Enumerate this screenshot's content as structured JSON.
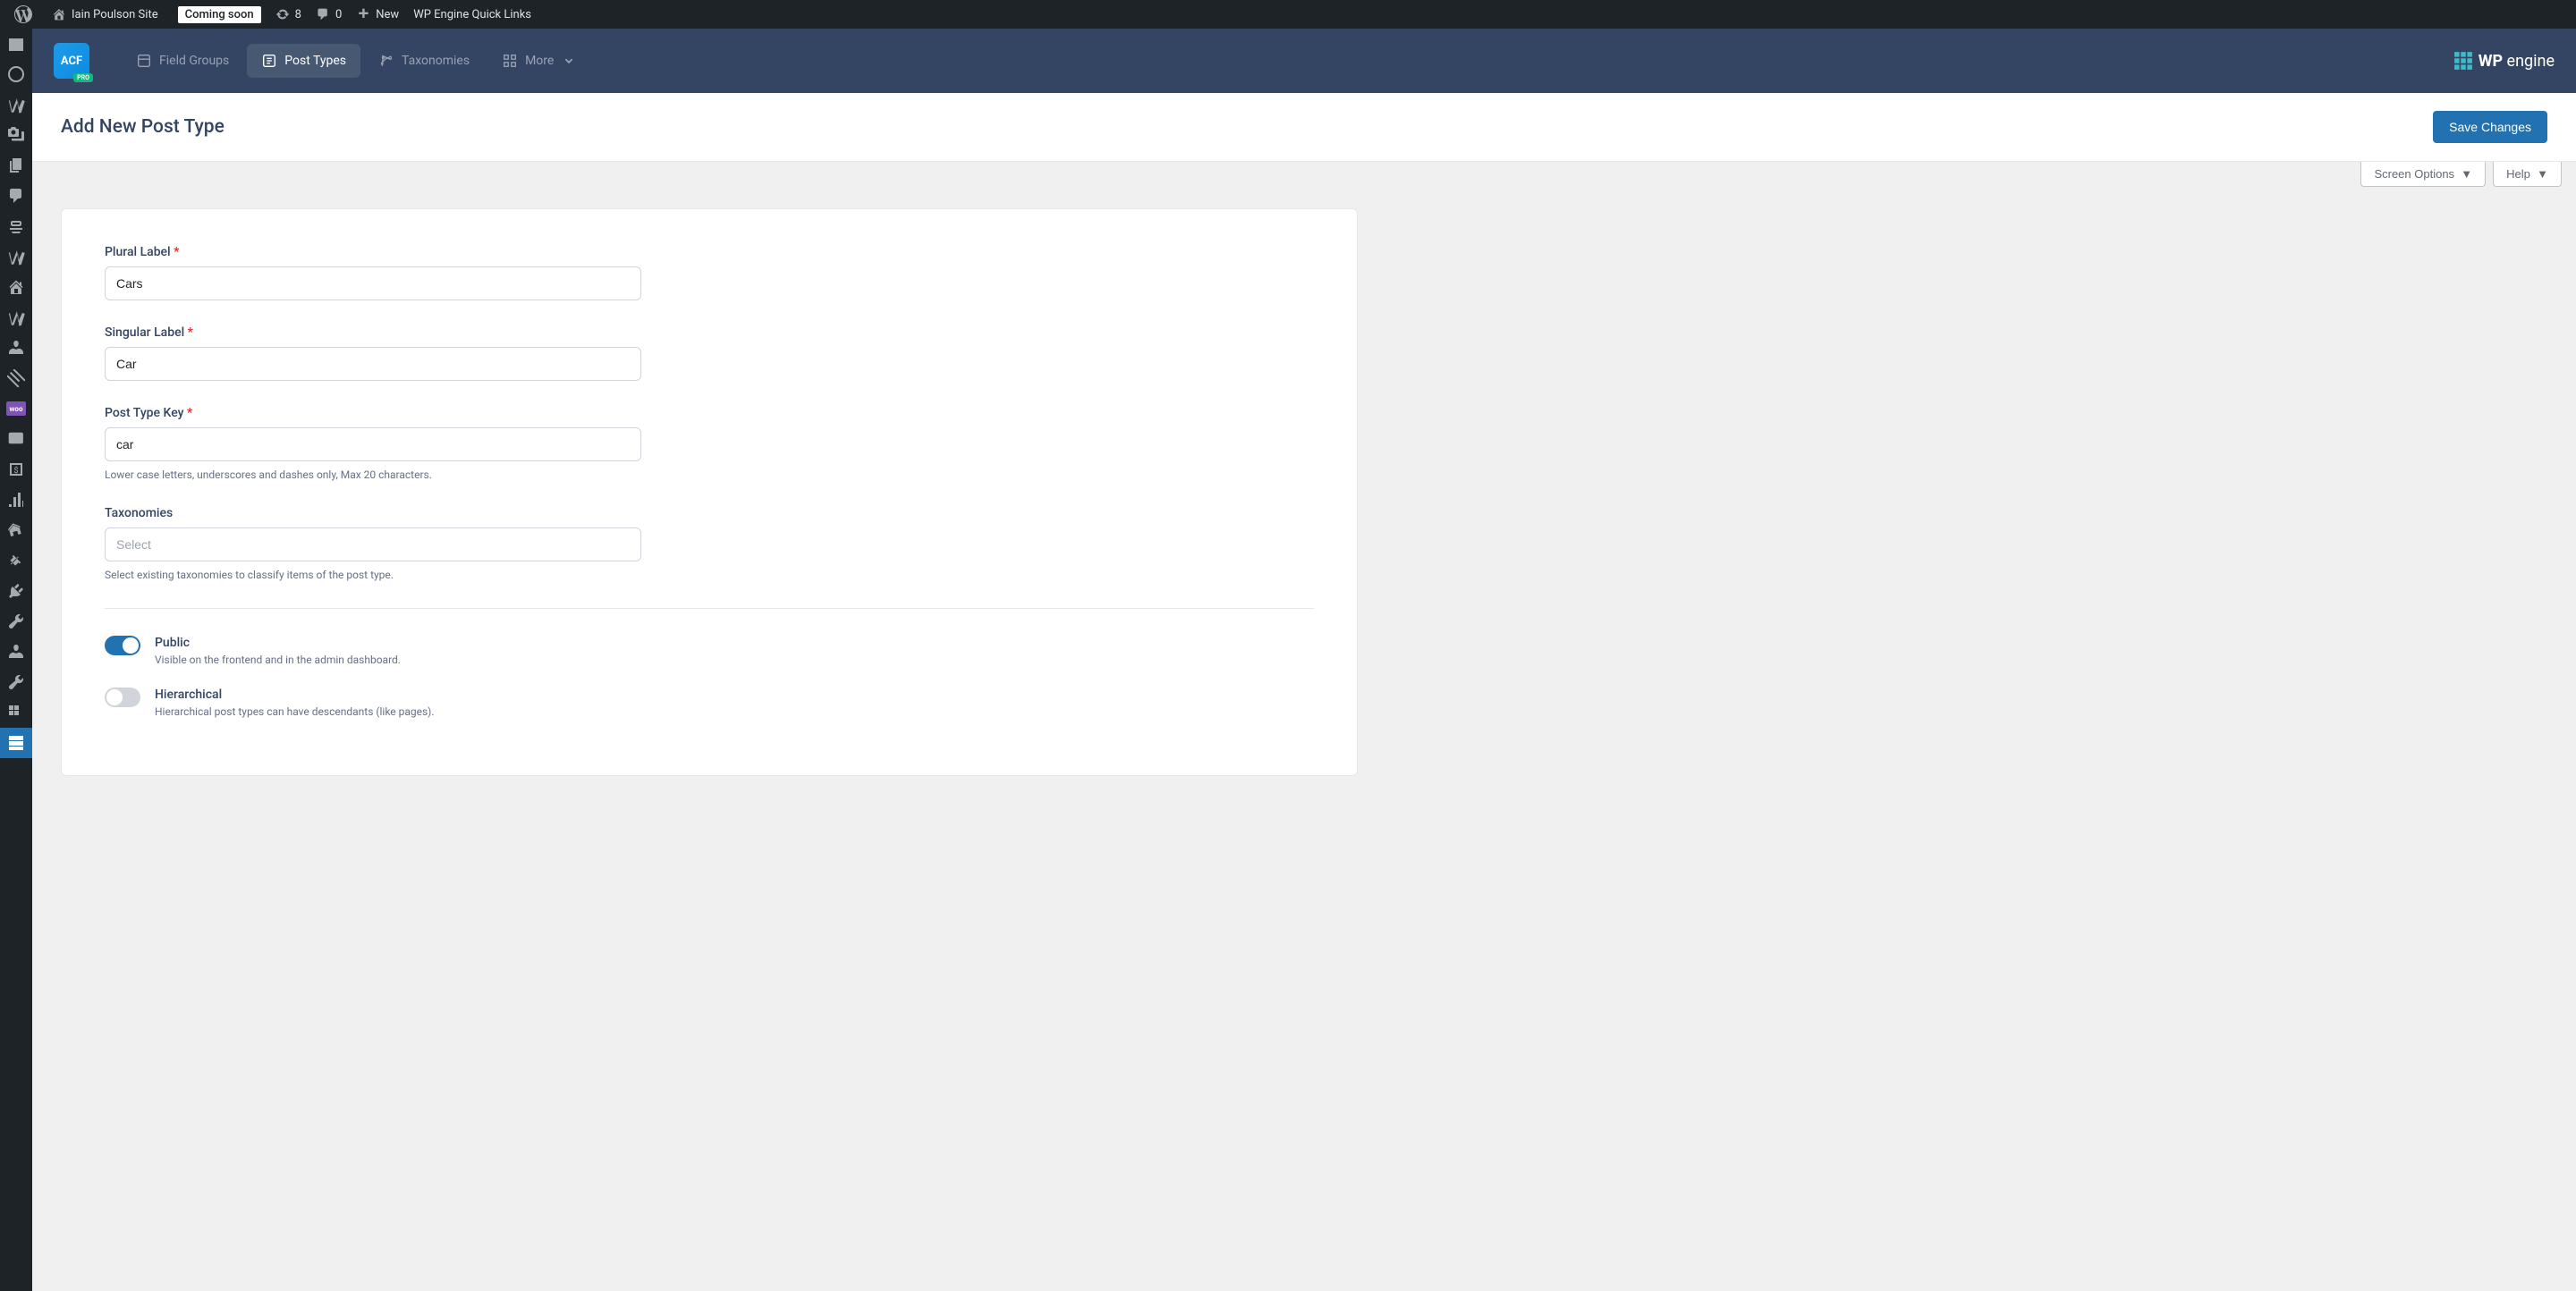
{
  "admin_bar": {
    "site_name": "Iain Poulson Site",
    "coming_soon": "Coming soon",
    "updates_count": "8",
    "comments_count": "0",
    "new_label": "New",
    "quick_links": "WP Engine Quick Links"
  },
  "acf_nav": {
    "field_groups": "Field Groups",
    "post_types": "Post Types",
    "taxonomies": "Taxonomies",
    "more": "More"
  },
  "wpengine_label": "WP engine",
  "page": {
    "title": "Add New Post Type",
    "save_button": "Save Changes",
    "screen_options": "Screen Options",
    "help": "Help"
  },
  "form": {
    "plural_label": {
      "label": "Plural Label",
      "value": "Cars"
    },
    "singular_label": {
      "label": "Singular Label",
      "value": "Car"
    },
    "post_type_key": {
      "label": "Post Type Key",
      "value": "car",
      "description": "Lower case letters, underscores and dashes only, Max 20 characters."
    },
    "taxonomies": {
      "label": "Taxonomies",
      "placeholder": "Select",
      "description": "Select existing taxonomies to classify items of the post type."
    },
    "public": {
      "label": "Public",
      "description": "Visible on the frontend and in the admin dashboard."
    },
    "hierarchical": {
      "label": "Hierarchical",
      "description": "Hierarchical post types can have descendants (like pages)."
    }
  }
}
